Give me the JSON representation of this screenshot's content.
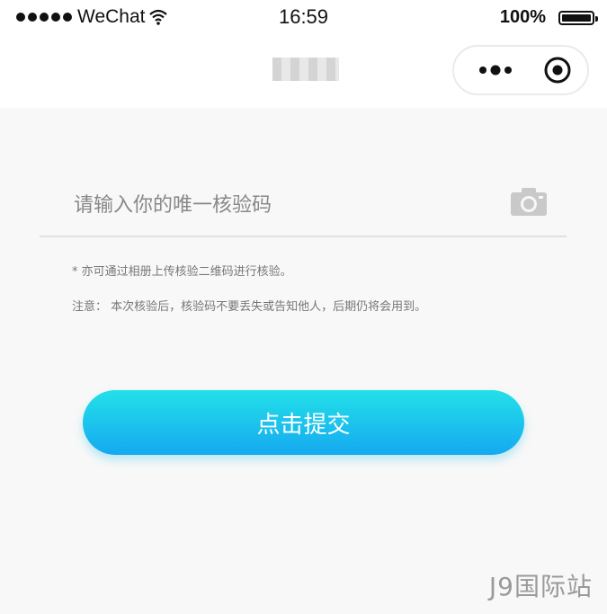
{
  "status_bar": {
    "carrier": "WeChat",
    "time": "16:59",
    "battery": "100%"
  },
  "nav": {
    "title": ""
  },
  "form": {
    "code_placeholder": "请输入你的唯一核验码",
    "tip_album": "* 亦可通过相册上传核验二维码进行核验。",
    "tip_notice": "注意： 本次核验后，核验码不要丢失或告知他人，后期仍将会用到。",
    "submit_label": "点击提交"
  },
  "watermark": "J9国际站",
  "icons": {
    "capsule_more": "more-dots-icon",
    "capsule_close": "target-close-icon",
    "camera": "camera-icon"
  },
  "colors": {
    "button_top": "#23e0e8",
    "button_bottom": "#15a9f0"
  }
}
